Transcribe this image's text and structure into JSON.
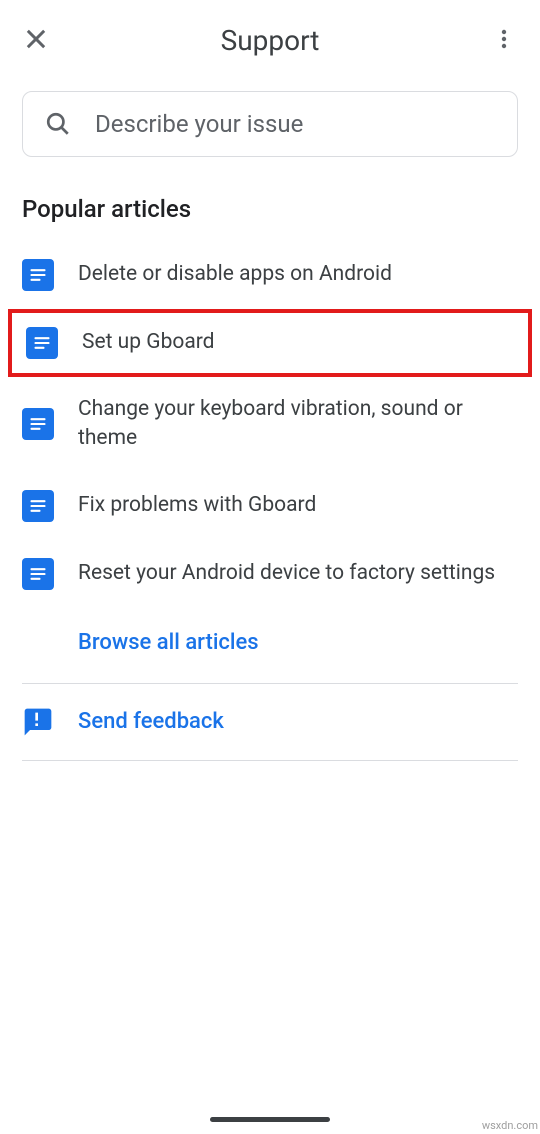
{
  "header": {
    "title": "Support"
  },
  "search": {
    "placeholder": "Describe your issue"
  },
  "section": {
    "title": "Popular articles"
  },
  "articles": [
    {
      "title": "Delete or disable apps on Android",
      "highlighted": false
    },
    {
      "title": "Set up Gboard",
      "highlighted": true
    },
    {
      "title": "Change your keyboard vibration, sound or theme",
      "highlighted": false
    },
    {
      "title": "Fix problems with Gboard",
      "highlighted": false
    },
    {
      "title": "Reset your Android device to factory settings",
      "highlighted": false
    }
  ],
  "browse_all": "Browse all articles",
  "feedback": "Send feedback",
  "watermark": "wsxdn.com"
}
